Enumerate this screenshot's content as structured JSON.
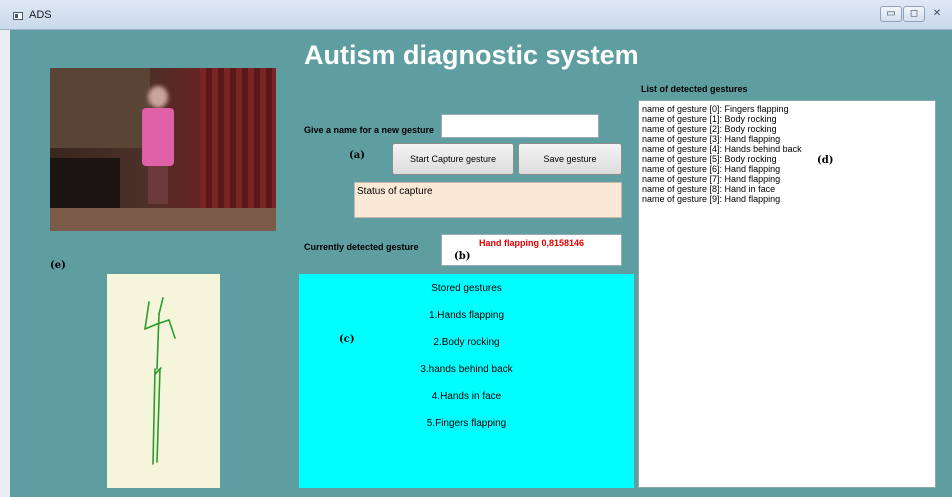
{
  "window": {
    "title": "ADS",
    "minimize_glyph": "▭",
    "maximize_glyph": "◻",
    "close_glyph": "✕"
  },
  "app": {
    "title": "Autism diagnostic system"
  },
  "capture": {
    "name_label": "Give a name for a new gesture",
    "name_value": "",
    "start_button": "Start Capture gesture",
    "save_button": "Save gesture",
    "status_text": "Status of capture"
  },
  "detection": {
    "label": "Currently detected gesture",
    "value": "Hand flapping 0,8158146"
  },
  "stored": {
    "title": "Stored gestures",
    "items": [
      "1.Hands flapping",
      "2.Body rocking",
      "3.hands behind back",
      "4.Hands in face",
      "5.Fingers flapping"
    ]
  },
  "detected_list": {
    "title": "List of detected gestures",
    "items": [
      "name of gesture [0]: Fingers flapping",
      "name of gesture [1]: Body rocking",
      "name of gesture [2]: Body rocking",
      "name of gesture [3]: Hand flapping",
      "name of gesture [4]: Hands behind back",
      "name of gesture [5]: Body rocking",
      "name of gesture [6]: Hand flapping",
      "name of gesture [7]: Hand flapping",
      "name of gesture [8]: Hand in face",
      "name of gesture [9]: Hand flapping"
    ]
  },
  "annotations": {
    "a": "(a)",
    "b": "(b)",
    "c": "(c)",
    "d": "(d)",
    "e": "(e)"
  },
  "colors": {
    "background": "#5f9ea0",
    "stored_panel": "#00ffff",
    "skeleton_panel": "#f5f5dc",
    "status_box": "#fbe9d7",
    "detected_text": "#e00000",
    "skeleton_stroke": "#2e9b2e"
  },
  "icons": {
    "app": "window-icon",
    "minimize": "minimize-icon",
    "maximize": "maximize-icon",
    "close": "close-icon"
  }
}
